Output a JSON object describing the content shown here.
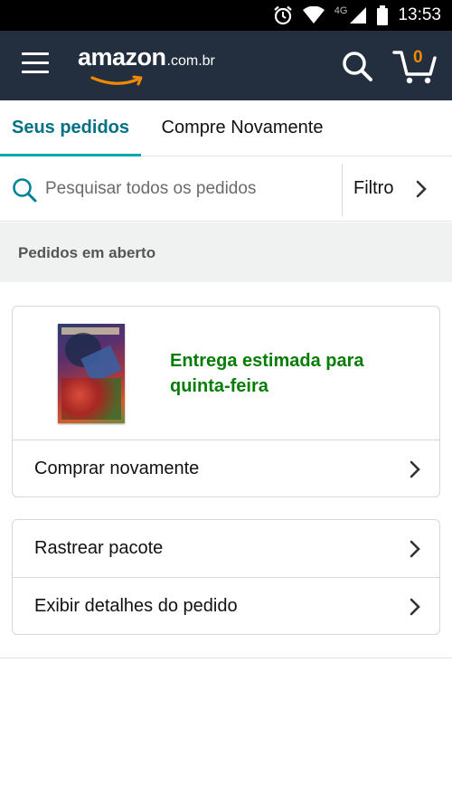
{
  "status_bar": {
    "network": "4G",
    "time": "13:53",
    "icons": [
      "alarm-icon",
      "wifi-icon",
      "signal-icon",
      "battery-icon"
    ]
  },
  "header": {
    "logo_word": "amazon",
    "logo_tld": ".com.br",
    "cart_count": "0",
    "icons": [
      "menu-icon",
      "search-icon",
      "cart-icon"
    ],
    "colors": {
      "background": "#232f3e",
      "cart_count": "#f08804"
    }
  },
  "tabs": [
    {
      "label": "Seus pedidos",
      "active": true
    },
    {
      "label": "Compre Novamente",
      "active": false
    }
  ],
  "search": {
    "placeholder": "Pesquisar todos os pedidos",
    "value": "",
    "filter_label": "Filtro"
  },
  "open_orders": {
    "section_title": "Pedidos em aberto",
    "order": {
      "delivery_text": "Entrega estimada para quinta-feira",
      "buy_again_label": "Comprar novamente"
    },
    "actions": [
      {
        "label": "Rastrear pacote"
      },
      {
        "label": "Exibir detalhes do pedido"
      }
    ]
  },
  "colors": {
    "accent_teal": "#007185",
    "tab_underline": "#00a8a8",
    "delivery_green": "#067d06"
  }
}
